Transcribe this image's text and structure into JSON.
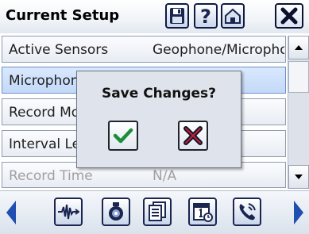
{
  "header": {
    "title": "Current Setup"
  },
  "rows": [
    {
      "label": "Active Sensors",
      "value": "Geophone/Microphone"
    },
    {
      "label": "Microphone",
      "value": ""
    },
    {
      "label": "Record Mode",
      "value": ""
    },
    {
      "label": "Interval Length",
      "value": ""
    },
    {
      "label": "Record Time",
      "value": "N/A"
    }
  ],
  "dialog": {
    "title": "Save Changes?"
  },
  "colors": {
    "accent": "#0e1a44",
    "confirm": "#1a8f3a",
    "cancel": "#c8202f",
    "selected_row": "#c9dcf7"
  }
}
